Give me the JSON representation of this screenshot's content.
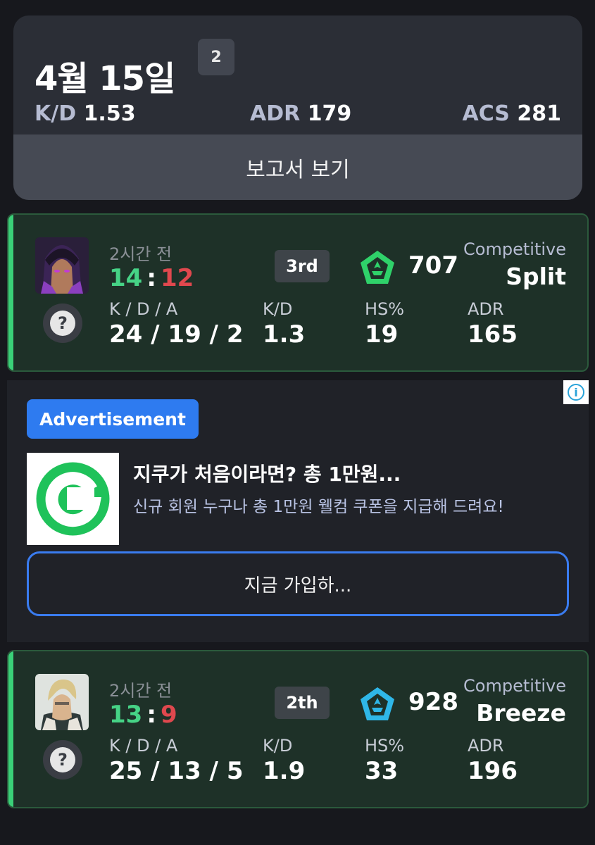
{
  "summary": {
    "date": "4월 15일",
    "count": "2",
    "kd": {
      "label": "K/D",
      "value": "1.53"
    },
    "adr": {
      "label": "ADR",
      "value": "179"
    },
    "acs": {
      "label": "ACS",
      "value": "281"
    },
    "report_button": "보고서 보기"
  },
  "stat_labels": {
    "kda": "K / D / A",
    "kd": "K/D",
    "hs": "HS%",
    "adr": "ADR"
  },
  "help_icon": "?",
  "matches": [
    {
      "time": "2시간 전",
      "score_win": "14",
      "score_sep": ":",
      "score_lose": "12",
      "place": "3rd",
      "rank_color": "#2fd26a",
      "rating": "707",
      "mode": "Competitive",
      "map": "Split",
      "kda": "24 / 19 / 2",
      "kd": "1.3",
      "hs": "19",
      "adr": "165",
      "agent_icon": "agent-reyna-portrait"
    },
    {
      "time": "2시간 전",
      "score_win": "13",
      "score_sep": ":",
      "score_lose": "9",
      "place": "2th",
      "rank_color": "#2fb7e8",
      "rating": "928",
      "mode": "Competitive",
      "map": "Breeze",
      "kda": "25 / 13 / 5",
      "kd": "1.9",
      "hs": "33",
      "adr": "196",
      "agent_icon": "agent-chamber-portrait"
    }
  ],
  "ad": {
    "tag": "Advertisement",
    "info_icon": "i",
    "headline": "지쿠가 처음이라면? 총 1만원...",
    "body": "신규 회원 누구나 총 1만원 웰컴 쿠폰을 지급해 드려요!",
    "cta": "지금 가입하...",
    "logo_color": "#1fc25a"
  }
}
